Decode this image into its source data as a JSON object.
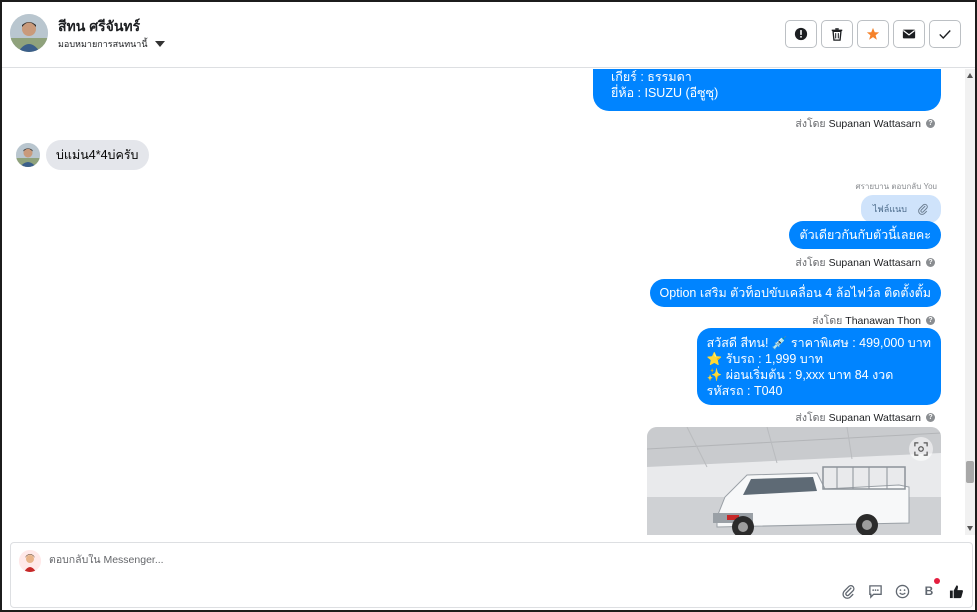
{
  "header": {
    "contact_name": "สีทน ศรีจันทร์",
    "assign_label": "มอบหมายการสนทนานี้",
    "actions": [
      "mark-spam",
      "delete",
      "star",
      "mark-unread",
      "done"
    ]
  },
  "messages": {
    "top_out": {
      "lines": [
        "เกียร์ : ธรรมดา",
        "ยี่ห้อ : ISUZU (อีซูซุ)"
      ],
      "sent_prefix": "ส่งโดย",
      "sent_by": "Supanan Wattasarn"
    },
    "incoming_1": {
      "text": "บ่แม่น4*4บ่ครับ"
    },
    "reply_note": "ศรายบาน ตอบกลับ You",
    "attachment_label": "ไฟล์แนบ",
    "out_2": {
      "text": "ตัวเดียวกันกับตัวนี้เลยคะ",
      "sent_prefix": "ส่งโดย",
      "sent_by": "Supanan Wattasarn"
    },
    "out_3": {
      "text": "Option เสริม ตัวท็อปขับเคลื่อน 4 ล้อไฟว์ล ติดตั้งตั้ม",
      "sent_prefix": "ส่งโดย",
      "sent_by": "Thanawan Thon"
    },
    "out_4": {
      "lines": [
        "สวัสดี สีทน! 💉 ราคาพิเศษ : 499,000 บาท",
        "⭐ รับรถ : 1,999 บาท",
        "✨ ผ่อนเริ่มต้น : 9,xxx บาท 84 งวด",
        "รหัสรถ : T040"
      ],
      "sent_prefix": "ส่งโดย",
      "sent_by": "Supanan Wattasarn"
    }
  },
  "composer": {
    "placeholder": "ตอบกลับใน Messenger...",
    "baht_symbol": "B"
  },
  "colors": {
    "outgoing_bubble": "#0084ff",
    "incoming_bubble": "#e4e6eb",
    "star": "#f5822a"
  }
}
